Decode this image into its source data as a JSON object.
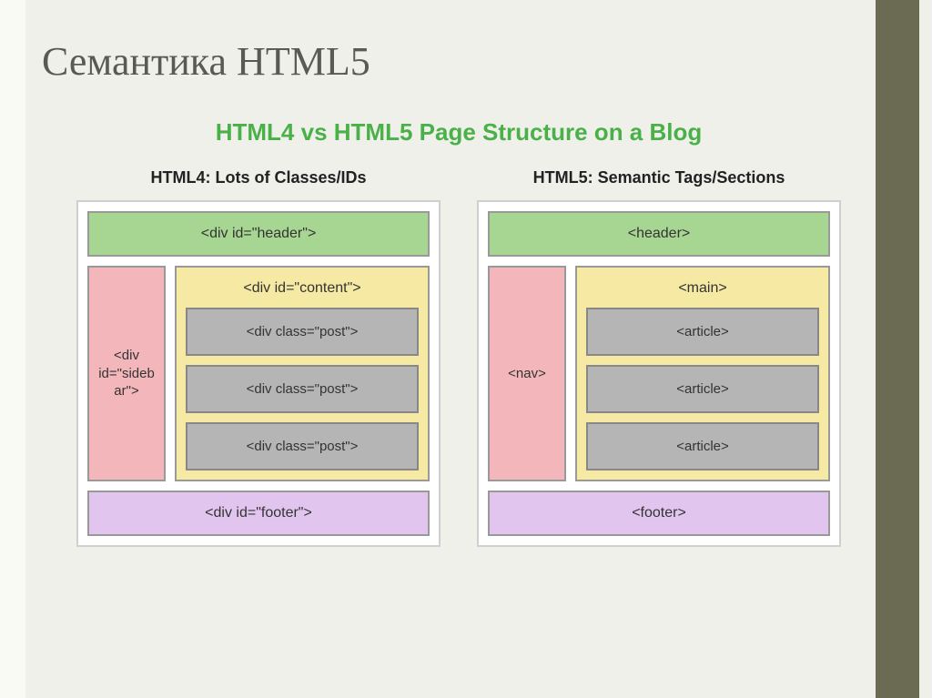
{
  "title": "Семантика HTML5",
  "subtitle": "HTML4 vs HTML5 Page Structure on a Blog",
  "html4": {
    "title": "HTML4: Lots of Classes/IDs",
    "header": "<div id=\"header\">",
    "sidebar": "<div id=\"sideb ar\">",
    "content": "<div id=\"content\">",
    "posts": [
      "<div class=\"post\">",
      "<div class=\"post\">",
      "<div class=\"post\">"
    ],
    "footer": "<div id=\"footer\">"
  },
  "html5": {
    "title": "HTML5: Semantic Tags/Sections",
    "header": "<header>",
    "sidebar": "<nav>",
    "content": "<main>",
    "posts": [
      "<article>",
      "<article>",
      "<article>"
    ],
    "footer": "<footer>"
  }
}
